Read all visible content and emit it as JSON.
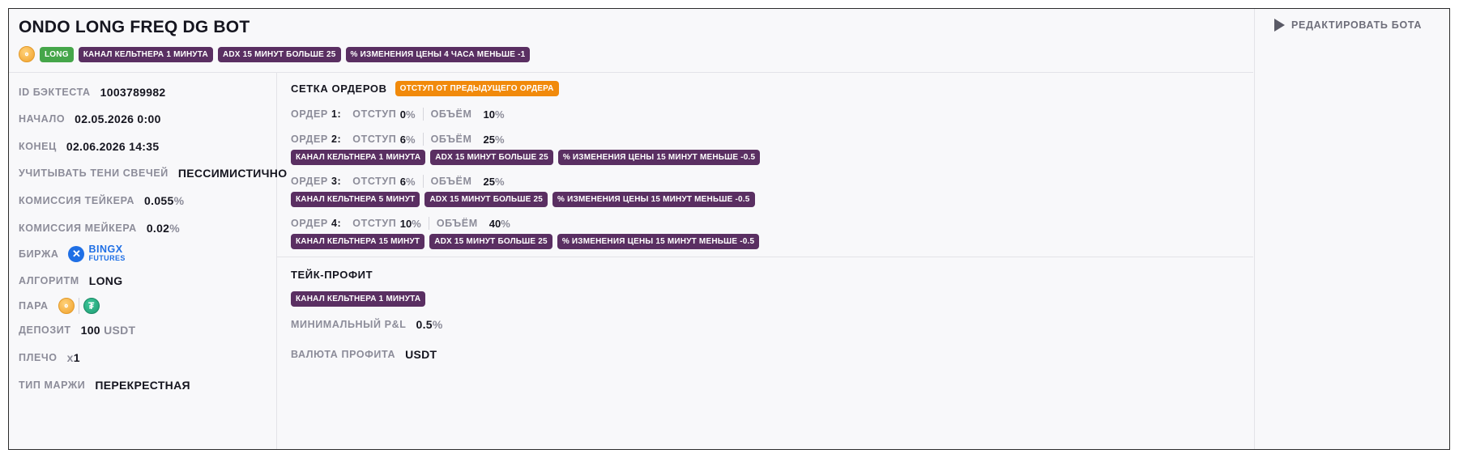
{
  "title": "ONDO LONG FREQ DG BOT",
  "header_tags": {
    "coin_glyph": "⚬",
    "direction": "LONG",
    "conditions": [
      "КАНАЛ КЕЛЬТНЕРА 1 МИНУТА",
      "ADX 15 МИНУТ БОЛЬШЕ 25",
      "% ИЗМЕНЕНИЯ ЦЕНЫ 4 ЧАСА МЕНЬШЕ -1"
    ]
  },
  "params": {
    "backtest_id": {
      "label": "ID БЭКТЕСТА",
      "value": "1003789982"
    },
    "start": {
      "label": "НАЧАЛО",
      "value": "02.05.2026 0:00"
    },
    "end": {
      "label": "КОНЕЦ",
      "value": "02.06.2026 14:35"
    },
    "shadows": {
      "label": "УЧИТЫВАТЬ ТЕНИ СВЕЧЕЙ",
      "value": "ПЕССИМИСТИЧНО"
    },
    "taker_fee": {
      "label": "КОМИССИЯ ТЕЙКЕРА",
      "value": "0.055",
      "unit": "%"
    },
    "maker_fee": {
      "label": "КОМИССИЯ МЕЙКЕРА",
      "value": "0.02",
      "unit": "%"
    },
    "exchange": {
      "label": "БИРЖА",
      "name": "BINGX",
      "sub": "FUTURES",
      "icon": "bingx-x-icon"
    },
    "algorithm": {
      "label": "АЛГОРИТМ",
      "value": "LONG"
    },
    "pair": {
      "label": "ПАРА",
      "base_glyph": "⚬",
      "quote_glyph": "₮"
    },
    "deposit": {
      "label": "ДЕПОЗИТ",
      "value": "100",
      "unit": "USDT"
    },
    "leverage": {
      "label": "ПЛЕЧО",
      "prefix": "x",
      "value": "1"
    },
    "margin": {
      "label": "ТИП МАРЖИ",
      "value": "ПЕРЕКРЕСТНАЯ"
    }
  },
  "order_grid": {
    "title": "СЕТКА ОРДЕРОВ",
    "badge": "ОТСТУП ОТ ПРЕДЫДУЩЕГО ОРДЕРА",
    "offset_label": "ОТСТУП",
    "volume_label": "ОБЪЁМ",
    "orders": [
      {
        "label": "ОРДЕР",
        "num": "1:",
        "offset": "0",
        "volume": "10",
        "conditions": []
      },
      {
        "label": "ОРДЕР",
        "num": "2:",
        "offset": "6",
        "volume": "25",
        "conditions": [
          "КАНАЛ КЕЛЬТНЕРА 1 МИНУТА",
          "ADX 15 МИНУТ БОЛЬШЕ 25",
          "% ИЗМЕНЕНИЯ ЦЕНЫ 15 МИНУТ МЕНЬШЕ -0.5"
        ]
      },
      {
        "label": "ОРДЕР",
        "num": "3:",
        "offset": "6",
        "volume": "25",
        "conditions": [
          "КАНАЛ КЕЛЬТНЕРА 5 МИНУТ",
          "ADX 15 МИНУТ БОЛЬШЕ 25",
          "% ИЗМЕНЕНИЯ ЦЕНЫ 15 МИНУТ МЕНЬШЕ -0.5"
        ]
      },
      {
        "label": "ОРДЕР",
        "num": "4:",
        "offset": "10",
        "volume": "40",
        "conditions": [
          "КАНАЛ КЕЛЬТНЕРА 15 МИНУТ",
          "ADX 15 МИНУТ БОЛЬШЕ 25",
          "% ИЗМЕНЕНИЯ ЦЕНЫ 15 МИНУТ МЕНЬШЕ -0.5"
        ]
      }
    ],
    "unit": "%"
  },
  "take_profit": {
    "title": "ТЕЙК-ПРОФИТ",
    "condition": "КАНАЛ КЕЛЬТНЕРА 1 МИНУТА",
    "min_pnl_label": "МИНИМАЛЬНЫЙ P&L",
    "min_pnl_value": "0.5",
    "min_pnl_unit": "%",
    "currency_label": "ВАЛЮТА ПРОФИТА",
    "currency_value": "USDT"
  },
  "actions": {
    "edit_label": "РЕДАКТИРОВАТЬ БОТА",
    "edit_icon": "play-icon"
  },
  "colors": {
    "tag_purple": "#5a2f62",
    "tag_green": "#45a64a",
    "tag_orange": "#f18a0b",
    "bingx_blue": "#1f6fe5"
  }
}
